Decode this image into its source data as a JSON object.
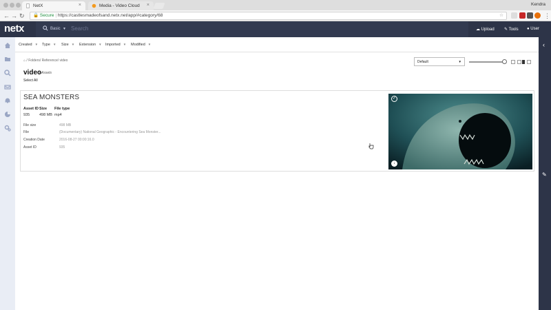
{
  "browser": {
    "tabs": [
      {
        "title": "NetX",
        "active": true
      },
      {
        "title": "Media - Video Cloud",
        "active": false
      }
    ],
    "profile_name": "Kendra",
    "address": {
      "secure_label": "Secure",
      "url": "https://castlesmadeofsand.netx.net/app/#category/68"
    }
  },
  "app": {
    "logo": "netx",
    "search": {
      "mode": "Basic",
      "placeholder": "Search"
    },
    "menu": {
      "upload": "Upload",
      "tools": "Tools",
      "user": "User"
    }
  },
  "filters": [
    "Created",
    "Type",
    "Size",
    "Extension",
    "Imported",
    "Modified"
  ],
  "breadcrumb": "/ Folders/ Reference/ video",
  "folder": {
    "title": "video",
    "count": "1 Assets",
    "select_all": "Select All"
  },
  "sort": {
    "selected": "Default"
  },
  "asset": {
    "name": "SEA MONSTERS",
    "headers": {
      "asset_id": "Asset ID",
      "size": "Size",
      "file_type": "File type"
    },
    "values": {
      "asset_id": "935",
      "size": "498 MB",
      "file_type": "mp4"
    },
    "metadata": [
      {
        "label": "File size",
        "value": "498 MB"
      },
      {
        "label": "File",
        "value": "(Documentary) National Geographic - Encountering Sea Monster..."
      },
      {
        "label": "Creation Date",
        "value": "2016-08-27 00:00:16.0"
      },
      {
        "label": "Asset ID",
        "value": "935"
      }
    ]
  },
  "colors": {
    "navbar": "#2d3448",
    "sidebar": "#e9edf5",
    "secure": "#1e8e3e"
  }
}
